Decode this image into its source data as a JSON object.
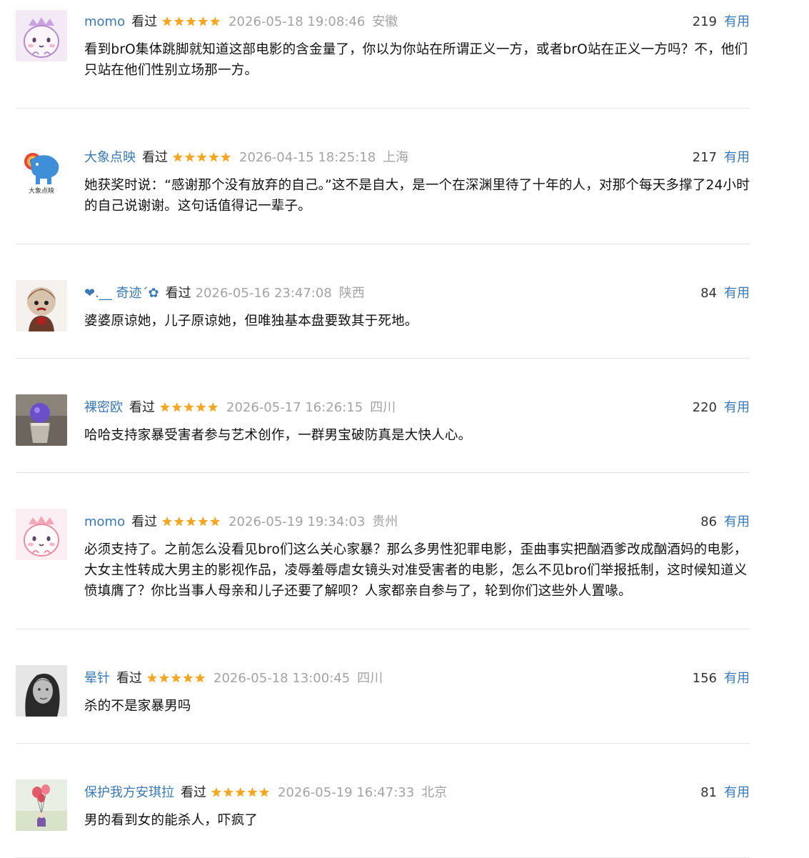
{
  "comments": [
    {
      "user": "momo",
      "status": "看过",
      "rating": 5,
      "time": "2026-05-18 19:08:46",
      "region": "安徽",
      "votes": "219",
      "useful_label": "有用",
      "text": "看到brO集体跳脚就知道这部电影的含金量了，你以为你站在所谓正义一方，或者brO站在正义一方吗？不，他们只站在他们性别立场那一方。",
      "avatar": "pink-dino-avatar"
    },
    {
      "user": "大象点映",
      "status": "看过",
      "rating": 5,
      "time": "2026-04-15 18:25:18",
      "region": "上海",
      "votes": "217",
      "useful_label": "有用",
      "text": "她获奖时说：“感谢那个没有放弃的自己。”这不是自大，是一个在深渊里待了十年的人，对那个每天多撑了24小时的自己说谢谢。这句话值得记一辈子。",
      "avatar": "elephant-logo-avatar",
      "avatar_caption": "大象点映"
    },
    {
      "user": "❤.__ 奇迹´✿",
      "status": "看过",
      "rating": 0,
      "time": "2026-05-16 23:47:08",
      "region": "陕西",
      "votes": "84",
      "useful_label": "有用",
      "text": "婆婆原谅她，儿子原谅她，但唯独基本盘要致其于死地。",
      "avatar": "doll-avatar"
    },
    {
      "user": "裸密欧",
      "status": "看过",
      "rating": 5,
      "time": "2026-05-17 16:26:15",
      "region": "四川",
      "votes": "220",
      "useful_label": "有用",
      "text": "哈哈支持家暴受害者参与艺术创作，一群男宝破防真是大快人心。",
      "avatar": "purple-cup-avatar"
    },
    {
      "user": "momo",
      "status": "看过",
      "rating": 5,
      "time": "2026-05-19 19:34:03",
      "region": "贵州",
      "votes": "86",
      "useful_label": "有用",
      "text": "必须支持了。之前怎么没看见bro们这么关心家暴？那么多男性犯罪电影，歪曲事实把酗酒爹改成酗酒妈的电影，大女主性转成大男主的影视作品，凌辱羞辱虐女镜头对准受害者的电影，怎么不见bro们举报抵制，这时候知道义愤填膺了？你比当事人母亲和儿子还要了解呗？人家都亲自参与了，轮到你们这些外人置喙。",
      "avatar": "pink-dino-avatar"
    },
    {
      "user": "晕针",
      "status": "看过",
      "rating": 5,
      "time": "2026-05-18 13:00:45",
      "region": "四川",
      "votes": "156",
      "useful_label": "有用",
      "text": "杀的不是家暴男吗",
      "avatar": "bw-portrait-avatar"
    },
    {
      "user": "保护我方安琪拉",
      "status": "看过",
      "rating": 5,
      "time": "2026-05-19 16:47:33",
      "region": "北京",
      "votes": "81",
      "useful_label": "有用",
      "text": "男的看到女的能杀人，吓疯了",
      "avatar": "balloon-avatar"
    }
  ],
  "colors": {
    "link": "#3a79b5",
    "star": "#f5a623",
    "muted": "#a3a3a3",
    "divider": "#e6e6e6"
  }
}
